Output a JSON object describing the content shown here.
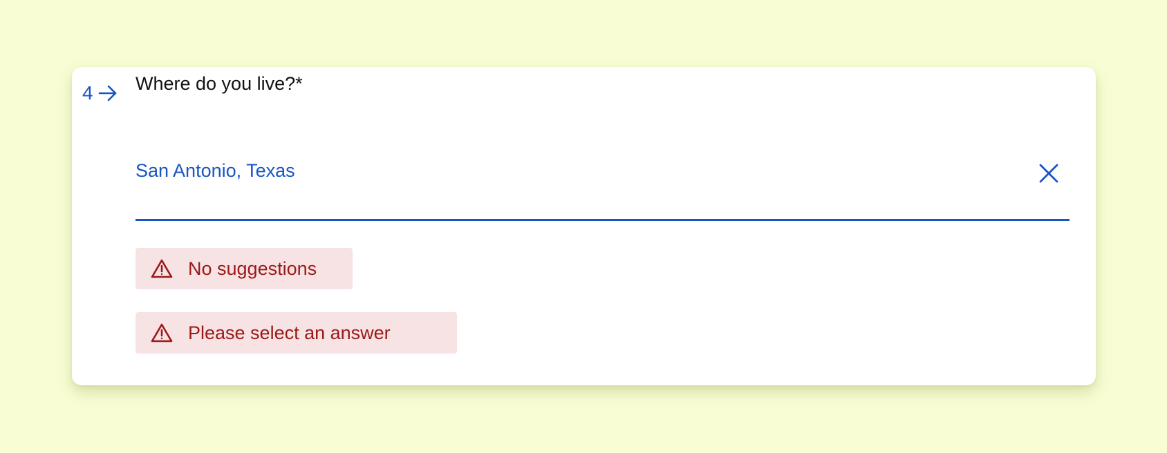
{
  "question": {
    "number": "4",
    "arrow_icon": "arrow-right-icon",
    "title": "Where do you live?*"
  },
  "answer": {
    "value": "San Antonio, Texas",
    "clear_icon": "close-icon"
  },
  "alerts": [
    {
      "icon": "warning-triangle-icon",
      "text": "No suggestions"
    },
    {
      "icon": "warning-triangle-icon",
      "text": "Please select an answer"
    }
  ],
  "colors": {
    "background": "#f8fdd4",
    "accent": "#1a55c4",
    "error_text": "#9b1919",
    "error_bg": "#f7e3e3",
    "title_text": "#111111"
  }
}
